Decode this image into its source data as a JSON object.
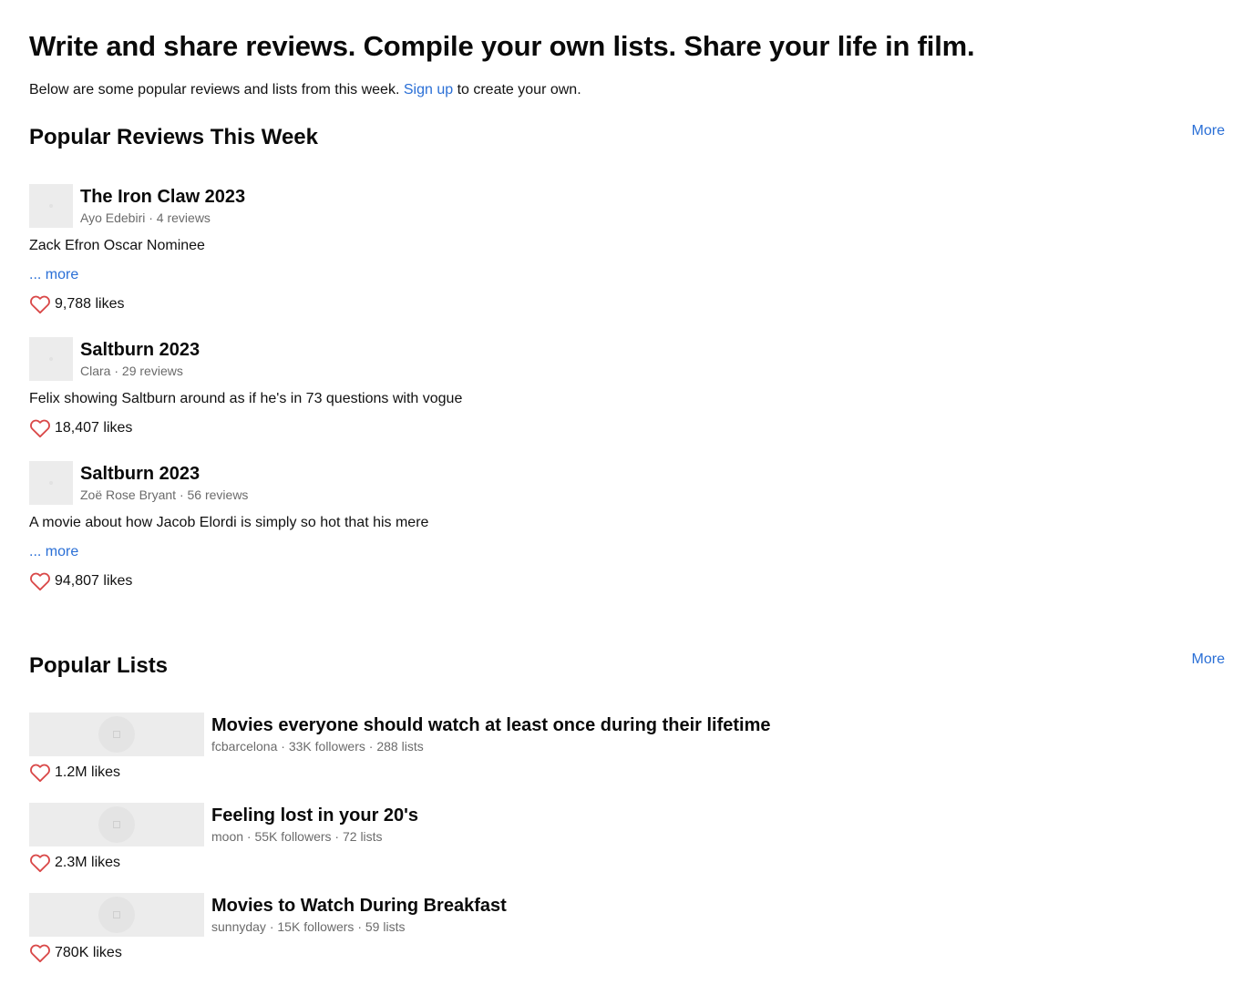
{
  "hero": {
    "title": "Write and share reviews. Compile your own lists. Share your life in film.",
    "intro_before": "Below are some popular reviews and lists from this week.",
    "signup_link": "Sign up",
    "intro_after": "to create your own."
  },
  "reviews_section": {
    "title": "Popular Reviews This Week",
    "more_label": "More",
    "items": [
      {
        "title": "The Iron Claw 2023",
        "author": "Ayo Edebiri",
        "reviews": "4 reviews",
        "body": "Zack Efron Oscar Nominee",
        "more": "... more",
        "likes": "9,788 likes"
      },
      {
        "title": "Saltburn 2023",
        "author": "Clara",
        "reviews": "29 reviews",
        "body": "Felix showing Saltburn around as if he's in 73 questions with vogue",
        "likes": "18,407 likes"
      },
      {
        "title": "Saltburn 2023",
        "author": "Zoë Rose Bryant",
        "reviews": "56 reviews",
        "body": "A movie about how Jacob Elordi is simply so hot that his mere",
        "more": "... more",
        "likes": "94,807 likes"
      }
    ]
  },
  "lists_section": {
    "title": "Popular Lists",
    "more_label": "More",
    "items": [
      {
        "title": "Movies everyone should watch at least once during their lifetime",
        "owner": "fcbarcelona",
        "followers": "33K followers",
        "lists": "288 lists",
        "likes": "1.2M likes"
      },
      {
        "title": "Feeling lost in your 20's",
        "owner": "moon",
        "followers": "55K followers",
        "lists": "72 lists",
        "likes": "2.3M likes"
      },
      {
        "title": "Movies to Watch During Breakfast",
        "owner": "sunnyday",
        "followers": "15K followers",
        "lists": "59 lists",
        "likes": "780K likes"
      }
    ]
  },
  "colors": {
    "link": "#2a6fd6",
    "heart": "#d94848",
    "muted_text": "#6b6b6b",
    "placeholder": "#ececec"
  },
  "icons": {
    "like": "heart-outline-icon"
  }
}
